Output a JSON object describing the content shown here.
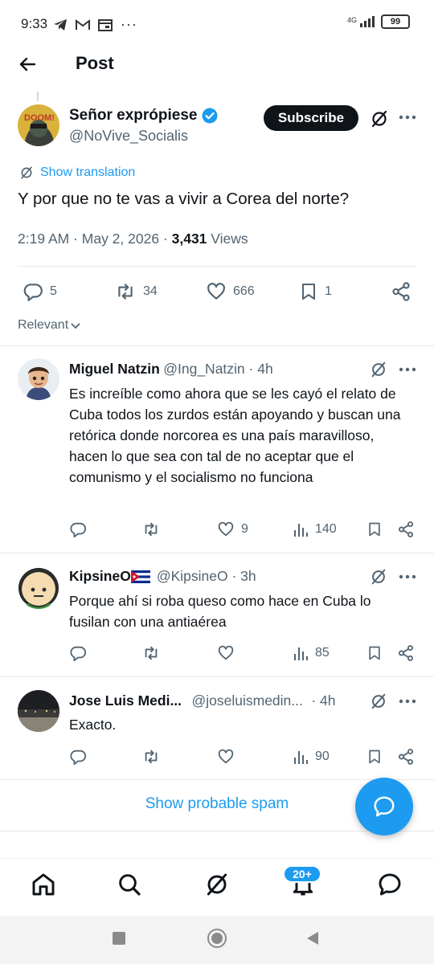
{
  "status_bar": {
    "time": "9:33",
    "network": "4G",
    "battery": "99"
  },
  "header": {
    "title": "Post"
  },
  "post": {
    "author_name": "Señor exprópiese",
    "author_handle": "@NoVive_Socialis",
    "subscribe_label": "Subscribe",
    "show_translation": "Show translation",
    "text": "Y por que no te vas a vivir a Corea del norte?",
    "time": "2:19 AM · May 2, 2026 · ",
    "views_count": "3,431",
    "views_label": " Views",
    "replies": "5",
    "reposts": "34",
    "likes": "666",
    "bookmarks": "1"
  },
  "sort": {
    "label": "Relevant"
  },
  "replies": [
    {
      "name": "Miguel Natzin",
      "handle": "@Ing_Natzin · 4h",
      "text": "Es increíble como ahora que se les cayó el relato de Cuba todos los zurdos están apoyando y buscan una retórica donde norcorea es una país maravilloso, hacen lo que sea con tal de no aceptar que el comunismo y el socialismo no funciona",
      "likes": "9",
      "views": "140"
    },
    {
      "name": "KipsineO",
      "flag": "🇨🇺",
      "handle": "@KipsineO · 3h",
      "text": "Porque ahí si roba queso como hace en Cuba lo fusilan con una antiaérea",
      "likes": "",
      "views": "85"
    },
    {
      "name": "Jose Luis Medi...",
      "handle": "@joseluismedin...",
      "time": "· 4h",
      "text": "Exacto.",
      "likes": "",
      "views": "90"
    }
  ],
  "spam": {
    "label": "Show probable spam"
  },
  "nav": {
    "badge": "20+"
  },
  "colors": {
    "accent": "#1d9bf0",
    "text": "#0f1419",
    "muted": "#536471"
  }
}
